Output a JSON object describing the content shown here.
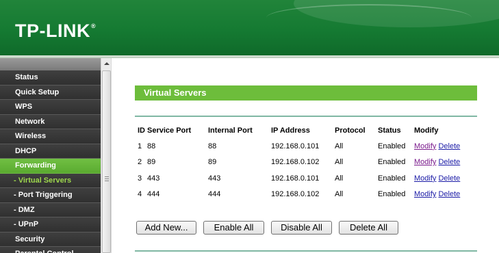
{
  "brand": {
    "logo": "TP-LINK",
    "trademark": "®"
  },
  "sidebar": {
    "items": [
      {
        "label": "Status",
        "type": "main"
      },
      {
        "label": "Quick Setup",
        "type": "main"
      },
      {
        "label": "WPS",
        "type": "main"
      },
      {
        "label": "Network",
        "type": "main"
      },
      {
        "label": "Wireless",
        "type": "main"
      },
      {
        "label": "DHCP",
        "type": "main"
      },
      {
        "label": "Forwarding",
        "type": "active"
      },
      {
        "label": "- Virtual Servers",
        "type": "sub-active"
      },
      {
        "label": "- Port Triggering",
        "type": "sub"
      },
      {
        "label": "- DMZ",
        "type": "sub"
      },
      {
        "label": "- UPnP",
        "type": "sub"
      },
      {
        "label": "Security",
        "type": "main"
      },
      {
        "label": "Parental Control",
        "type": "main"
      }
    ]
  },
  "main": {
    "title": "Virtual Servers",
    "table": {
      "headers": [
        "ID",
        "Service Port",
        "Internal Port",
        "IP Address",
        "Protocol",
        "Status",
        "Modify"
      ],
      "rows": [
        {
          "id": "1",
          "service_port": "88",
          "internal_port": "88",
          "ip": "192.168.0.101",
          "protocol": "All",
          "status": "Enabled",
          "modify": "Modify",
          "delete": "Delete"
        },
        {
          "id": "2",
          "service_port": "89",
          "internal_port": "89",
          "ip": "192.168.0.102",
          "protocol": "All",
          "status": "Enabled",
          "modify": "Modify",
          "delete": "Delete"
        },
        {
          "id": "3",
          "service_port": "443",
          "internal_port": "443",
          "ip": "192.168.0.101",
          "protocol": "All",
          "status": "Enabled",
          "modify": "Modify",
          "delete": "Delete"
        },
        {
          "id": "4",
          "service_port": "444",
          "internal_port": "444",
          "ip": "192.168.0.102",
          "protocol": "All",
          "status": "Enabled",
          "modify": "Modify",
          "delete": "Delete"
        }
      ]
    },
    "buttons": {
      "add_new": "Add New...",
      "enable_all": "Enable All",
      "disable_all": "Disable All",
      "delete_all": "Delete All"
    }
  },
  "colors": {
    "brand_green": "#157a32",
    "accent_green": "#6dbd3b",
    "sidebar_dark": "#3b3b3b",
    "link_blue": "#1a1aa6",
    "link_visited": "#7a1a8c"
  }
}
